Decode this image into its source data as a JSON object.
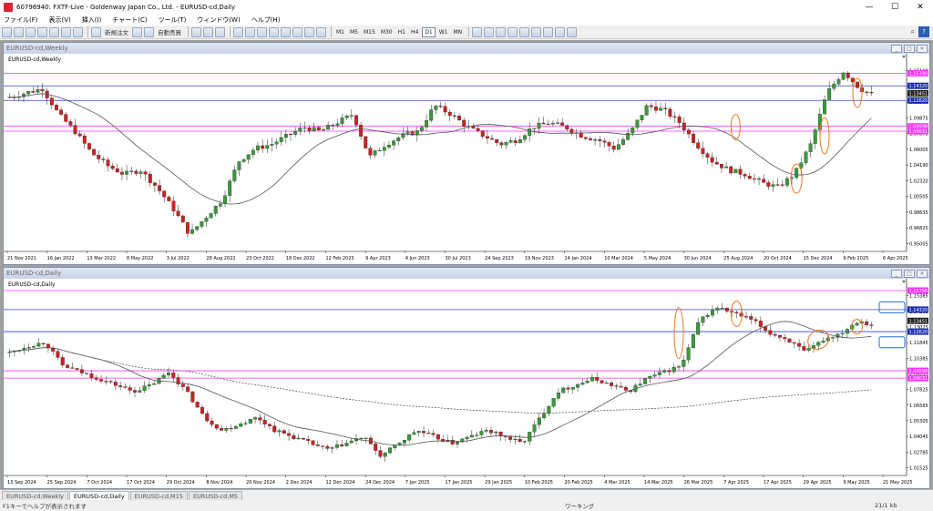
{
  "titlebar": {
    "title": "60796940: FXTF-Live - Goldenway Japan Co., Ltd. - EURUSD-cd,Daily",
    "minimize": "—",
    "maximize": "☐",
    "close": "✕"
  },
  "menu": [
    "ファイル(F)",
    "表示(V)",
    "挿入(I)",
    "チャート(C)",
    "ツール(T)",
    "ウィンドウ(W)",
    "ヘルプ(H)"
  ],
  "toolbar": {
    "new_order": "新規注文",
    "auto_trade": "自動売買",
    "timeframes": [
      "M1",
      "M5",
      "M15",
      "M30",
      "H1",
      "H4",
      "D1",
      "W1",
      "MN"
    ],
    "selected_timeframe": "D1",
    "search_icon": "magnifier-icon"
  },
  "weekly": {
    "window_title": "EURUSD-cd,Weekly",
    "chart_label": "EURUSD-cd,Weekly"
  },
  "daily": {
    "window_title": "EURUSD-cd,Daily",
    "chart_label": "EURUSD-cd,Daily"
  },
  "tabs": [
    "EURUSD-cd,Weekly",
    "EURUSD-cd,Daily",
    "EURUSD-cd,M15",
    "EURUSD-cd,M5"
  ],
  "active_tab": "EURUSD-cd,Daily",
  "status": {
    "help": "F1キーでヘルプが表示されます",
    "profile": "ワーキング",
    "traffic": "21/1 kb"
  },
  "colors": {
    "bull": "#3a9a3a",
    "bear": "#cc2222",
    "ma": "#555555",
    "magenta_line": "#ff33ff",
    "blue_line": "#3344cc",
    "orange_ellipse": "#ee7722",
    "cyan_box": "#1e6fd0",
    "price_label_blue": "#1a2fb0",
    "price_label_magenta": "#ff33ff"
  },
  "chart_data": [
    {
      "name": "EURUSD-cd,Weekly",
      "type": "candlestick",
      "ylim": [
        0.95005,
        1.17
      ],
      "price_labels": [
        "1.15190",
        "1.13015",
        "1.11560",
        "1.09875",
        "1.07875",
        "1.06005",
        "1.04190",
        "1.02320",
        "1.00505",
        "0.98635",
        "0.96820",
        "0.95005"
      ],
      "x_labels": [
        "21 Nov 2021",
        "16 Jan 2022",
        "13 Mar 2022",
        "8 May 2022",
        "3 Jul 2022",
        "28 Aug 2022",
        "23 Oct 2022",
        "18 Dec 2022",
        "12 Feb 2023",
        "9 Apr 2023",
        "4 Jun 2023",
        "30 Jul 2023",
        "24 Sep 2023",
        "19 Nov 2023",
        "14 Jan 2024",
        "10 Mar 2024",
        "5 May 2024",
        "30 Jun 2024",
        "25 Aug 2024",
        "20 Oct 2024",
        "15 Dec 2024",
        "9 Feb 2025",
        "6 Apr 2025"
      ],
      "hlines": [
        {
          "price": 1.1579,
          "color": "magenta",
          "label": "1.15790"
        },
        {
          "price": 1.1432,
          "color": "blue",
          "label": "1.14320"
        },
        {
          "price": 1.13451,
          "color": "dark",
          "label": "1.13451"
        },
        {
          "price": 1.1262,
          "color": "blue",
          "label": "1.12620"
        },
        {
          "price": 1.09598,
          "color": "magenta",
          "label": "1.09598"
        },
        {
          "price": 1.09031,
          "color": "magenta",
          "label": "1.09031"
        }
      ],
      "anchors": [
        1.13,
        1.135,
        1.14,
        1.11,
        1.09,
        1.065,
        1.05,
        1.04,
        1.045,
        1.025,
        1.0,
        0.97,
        0.99,
        1.01,
        1.055,
        1.07,
        1.075,
        1.085,
        1.095,
        1.09,
        1.1,
        1.11,
        1.06,
        1.075,
        1.085,
        1.09,
        1.12,
        1.11,
        1.095,
        1.085,
        1.075,
        1.08,
        1.095,
        1.1,
        1.095,
        1.085,
        1.08,
        1.07,
        1.09,
        1.12,
        1.115,
        1.1,
        1.075,
        1.055,
        1.045,
        1.04,
        1.03,
        1.025,
        1.04,
        1.075,
        1.135,
        1.16,
        1.14,
        1.13
      ]
    },
    {
      "name": "EURUSD-cd,Daily",
      "type": "candlestick",
      "ylim": [
        1.0152,
        1.16
      ],
      "price_labels": [
        "1.15385",
        "1.14205",
        "1.13025",
        "1.11845",
        "1.10385",
        "1.09205",
        "1.07825",
        "1.06565",
        "1.05305",
        "1.04045",
        "1.02785",
        "1.01525"
      ],
      "x_labels": [
        "13 Sep 2024",
        "25 Sep 2024",
        "7 Oct 2024",
        "17 Oct 2024",
        "29 Oct 2024",
        "8 Nov 2024",
        "20 Nov 2024",
        "2 Dec 2024",
        "12 Dec 2024",
        "24 Dec 2024",
        "7 Jan 2025",
        "17 Jan 2025",
        "29 Jan 2025",
        "10 Feb 2025",
        "20 Feb 2025",
        "4 Mar 2025",
        "14 Mar 2025",
        "26 Mar 2025",
        "7 Apr 2025",
        "17 Apr 2025",
        "29 Apr 2025",
        "9 May 2025",
        "21 May 2025"
      ],
      "hlines": [
        {
          "price": 1.1579,
          "color": "magenta",
          "label": "1.15790"
        },
        {
          "price": 1.1432,
          "color": "blue",
          "label": "1.14320"
        },
        {
          "price": 1.13451,
          "color": "dark",
          "label": "1.13451"
        },
        {
          "price": 1.1262,
          "color": "blue",
          "label": "1.12620"
        },
        {
          "price": 1.09598,
          "color": "magenta",
          "label": "1.09598"
        },
        {
          "price": 1.09031,
          "color": "magenta",
          "label": "1.09031"
        }
      ],
      "anchors": [
        1.11,
        1.115,
        1.118,
        1.1,
        1.095,
        1.09,
        1.085,
        1.08,
        1.085,
        1.095,
        1.08,
        1.06,
        1.05,
        1.055,
        1.06,
        1.05,
        1.045,
        1.04,
        1.035,
        1.04,
        1.045,
        1.03,
        1.04,
        1.05,
        1.045,
        1.04,
        1.045,
        1.05,
        1.045,
        1.04,
        1.06,
        1.08,
        1.085,
        1.09,
        1.085,
        1.08,
        1.09,
        1.095,
        1.1,
        1.135,
        1.145,
        1.14,
        1.135,
        1.125,
        1.12,
        1.11,
        1.12,
        1.125,
        1.135,
        1.13
      ]
    }
  ]
}
